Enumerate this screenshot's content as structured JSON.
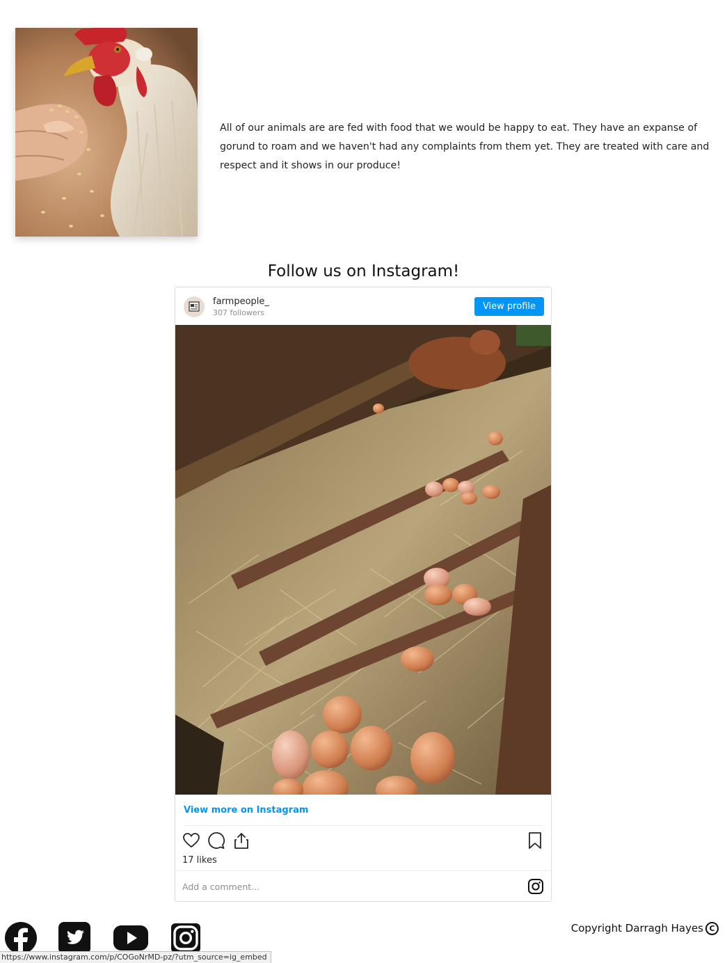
{
  "about": {
    "text": "All of our animals are are fed with food that we would be happy to eat. They have an expanse of gorund to roam and we haven't had any complaints from them yet. They are treated with care and respect and it shows in our produce!"
  },
  "instagram": {
    "heading": "Follow us on Instagram!",
    "username": "farmpeople_",
    "followers": "307 followers",
    "view_profile_label": "View profile",
    "view_more_label": "View more on Instagram",
    "likes": "17 likes",
    "comment_placeholder": "Add a comment...",
    "accent_color": "#0095f6",
    "icons": [
      "heart-icon",
      "comment-icon",
      "share-icon",
      "bookmark-icon",
      "instagram-icon"
    ]
  },
  "footer": {
    "social_icons": [
      "facebook-icon",
      "twitter-icon",
      "youtube-icon",
      "instagram-icon"
    ],
    "copyright": "Copyright Darragh Hayes",
    "copyright_symbol": "C"
  },
  "status_bar": {
    "url": "https://www.instagram.com/p/COGoNrMD-pz/?utm_source=ig_embed"
  }
}
